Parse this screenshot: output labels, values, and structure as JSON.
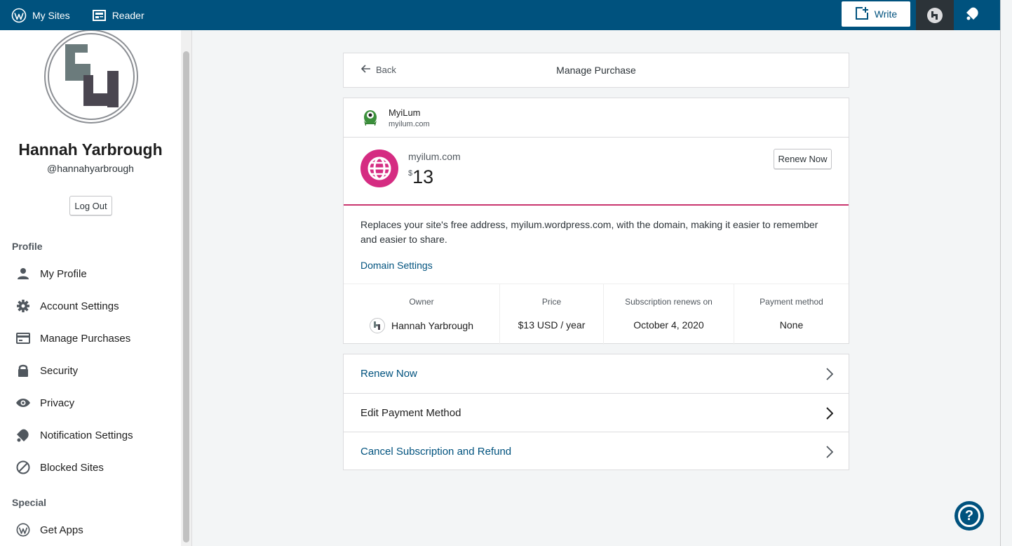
{
  "masterbar": {
    "my_sites": "My Sites",
    "reader": "Reader",
    "write": "Write"
  },
  "sidebar": {
    "name": "Hannah Yarbrough",
    "handle": "@hannahyarbrough",
    "logout": "Log Out",
    "profile_heading": "Profile",
    "special_heading": "Special",
    "items": [
      {
        "label": "My Profile",
        "icon": "user-icon"
      },
      {
        "label": "Account Settings",
        "icon": "gear-icon"
      },
      {
        "label": "Manage Purchases",
        "icon": "credit-card-icon"
      },
      {
        "label": "Security",
        "icon": "lock-icon"
      },
      {
        "label": "Privacy",
        "icon": "eye-icon"
      },
      {
        "label": "Notification Settings",
        "icon": "bell-icon"
      },
      {
        "label": "Blocked Sites",
        "icon": "block-icon"
      }
    ],
    "special_items": [
      {
        "label": "Get Apps",
        "icon": "wordpress-icon"
      }
    ]
  },
  "header": {
    "back": "Back",
    "title": "Manage Purchase"
  },
  "purchase": {
    "site_name": "MyiLum",
    "site_url": "myilum.com",
    "product_domain": "myilum.com",
    "currency_symbol": "$",
    "price_amount": "13",
    "renew_button": "Renew Now",
    "description": "Replaces your site's free address, myilum.wordpress.com, with the domain, making it easier to remember and easier to share.",
    "domain_settings": "Domain Settings",
    "meta": {
      "owner_label": "Owner",
      "owner_value": "Hannah Yarbrough",
      "price_label": "Price",
      "price_value": "$13 USD / year",
      "renews_label": "Subscription renews on",
      "renews_value": "October 4, 2020",
      "payment_label": "Payment method",
      "payment_value": "None"
    }
  },
  "actions": [
    {
      "label": "Renew Now",
      "color": "#00527e"
    },
    {
      "label": "Edit Payment Method",
      "color": "#1e1e1e"
    },
    {
      "label": "Cancel Subscription and Refund",
      "color": "#00527e"
    }
  ],
  "colors": {
    "brand": "#00527e",
    "accent_pink": "#d52c82",
    "divider_pink": "#c9356e"
  }
}
